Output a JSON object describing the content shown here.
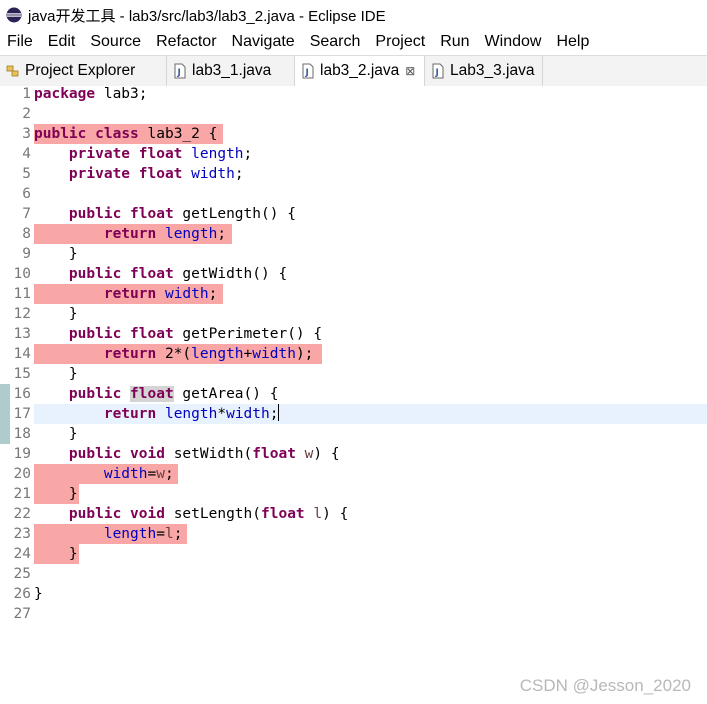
{
  "window": {
    "title": "java开发工具 - lab3/src/lab3/lab3_2.java - Eclipse IDE"
  },
  "menu": [
    "File",
    "Edit",
    "Source",
    "Refactor",
    "Navigate",
    "Search",
    "Project",
    "Run",
    "Window",
    "Help"
  ],
  "tabs": [
    {
      "label": "Project Explorer"
    },
    {
      "label": "lab3_1.java"
    },
    {
      "label": "lab3_2.java",
      "active": true,
      "close": "⊠"
    },
    {
      "label": "Lab3_3.java"
    }
  ],
  "code": {
    "lines": [
      {
        "n": "1",
        "t": [
          [
            "kw",
            "package"
          ],
          [
            "t",
            " lab3;"
          ]
        ]
      },
      {
        "n": "2",
        "t": []
      },
      {
        "n": "3",
        "t": [
          [
            "kw",
            "public"
          ],
          [
            "t",
            " "
          ],
          [
            "kw",
            "class"
          ],
          [
            "t",
            " lab3_2 {"
          ]
        ]
      },
      {
        "n": "4",
        "t": [
          [
            "t",
            "    "
          ],
          [
            "kw",
            "private"
          ],
          [
            "t",
            " "
          ],
          [
            "kw",
            "float"
          ],
          [
            "t",
            " "
          ],
          [
            "fd",
            "length"
          ],
          [
            "t",
            ";"
          ]
        ]
      },
      {
        "n": "5",
        "t": [
          [
            "t",
            "    "
          ],
          [
            "kw",
            "private"
          ],
          [
            "t",
            " "
          ],
          [
            "kw",
            "float"
          ],
          [
            "t",
            " "
          ],
          [
            "fd",
            "width"
          ],
          [
            "t",
            ";"
          ]
        ]
      },
      {
        "n": "6",
        "t": []
      },
      {
        "n": "7",
        "t": [
          [
            "t",
            "    "
          ],
          [
            "kw",
            "public"
          ],
          [
            "t",
            " "
          ],
          [
            "kw",
            "float"
          ],
          [
            "t",
            " getLength() {"
          ]
        ]
      },
      {
        "n": "8",
        "t": [
          [
            "t",
            "        "
          ],
          [
            "kw",
            "return"
          ],
          [
            "t",
            " "
          ],
          [
            "fd",
            "length"
          ],
          [
            "t",
            ";"
          ]
        ]
      },
      {
        "n": "9",
        "t": [
          [
            "t",
            "    }"
          ]
        ]
      },
      {
        "n": "10",
        "t": [
          [
            "t",
            "    "
          ],
          [
            "kw",
            "public"
          ],
          [
            "t",
            " "
          ],
          [
            "kw",
            "float"
          ],
          [
            "t",
            " getWidth() {"
          ]
        ]
      },
      {
        "n": "11",
        "t": [
          [
            "t",
            "        "
          ],
          [
            "kw",
            "return"
          ],
          [
            "t",
            " "
          ],
          [
            "fd",
            "width"
          ],
          [
            "t",
            ";"
          ]
        ]
      },
      {
        "n": "12",
        "t": [
          [
            "t",
            "    }"
          ]
        ]
      },
      {
        "n": "13",
        "t": [
          [
            "t",
            "    "
          ],
          [
            "kw",
            "public"
          ],
          [
            "t",
            " "
          ],
          [
            "kw",
            "float"
          ],
          [
            "t",
            " getPerimeter() {"
          ]
        ]
      },
      {
        "n": "14",
        "t": [
          [
            "t",
            "        "
          ],
          [
            "kw",
            "return"
          ],
          [
            "t",
            " 2*("
          ],
          [
            "fd",
            "length"
          ],
          [
            "t",
            "+"
          ],
          [
            "fd",
            "width"
          ],
          [
            "t",
            ");"
          ]
        ]
      },
      {
        "n": "15",
        "t": [
          [
            "t",
            "    }"
          ]
        ]
      },
      {
        "n": "16",
        "t": [
          [
            "t",
            "    "
          ],
          [
            "kw",
            "public"
          ],
          [
            "t",
            " "
          ],
          [
            "kwocc",
            "float"
          ],
          [
            "t",
            " getArea() {"
          ]
        ]
      },
      {
        "n": "17",
        "t": [
          [
            "t",
            "        "
          ],
          [
            "kw",
            "return"
          ],
          [
            "t",
            " "
          ],
          [
            "fd",
            "length"
          ],
          [
            "t",
            "*"
          ],
          [
            "fd",
            "width"
          ],
          [
            "t",
            ";"
          ],
          [
            "caret",
            ""
          ]
        ]
      },
      {
        "n": "18",
        "t": [
          [
            "t",
            "    }"
          ]
        ]
      },
      {
        "n": "19",
        "t": [
          [
            "t",
            "    "
          ],
          [
            "kw",
            "public"
          ],
          [
            "t",
            " "
          ],
          [
            "kw",
            "void"
          ],
          [
            "t",
            " setWidth("
          ],
          [
            "kw",
            "float"
          ],
          [
            "t",
            " "
          ],
          [
            "pm",
            "w"
          ],
          [
            "t",
            ") {"
          ]
        ]
      },
      {
        "n": "20",
        "t": [
          [
            "t",
            "        "
          ],
          [
            "fd",
            "width"
          ],
          [
            "t",
            "="
          ],
          [
            "pm",
            "w"
          ],
          [
            "t",
            ";"
          ]
        ]
      },
      {
        "n": "21",
        "t": [
          [
            "t",
            "    }"
          ]
        ]
      },
      {
        "n": "22",
        "t": [
          [
            "t",
            "    "
          ],
          [
            "kw",
            "public"
          ],
          [
            "t",
            " "
          ],
          [
            "kw",
            "void"
          ],
          [
            "t",
            " setLength("
          ],
          [
            "kw",
            "float"
          ],
          [
            "t",
            " "
          ],
          [
            "pm",
            "l"
          ],
          [
            "t",
            ") {"
          ]
        ]
      },
      {
        "n": "23",
        "t": [
          [
            "t",
            "        "
          ],
          [
            "fd",
            "length"
          ],
          [
            "t",
            "="
          ],
          [
            "pm",
            "l"
          ],
          [
            "t",
            ";"
          ]
        ]
      },
      {
        "n": "24",
        "t": [
          [
            "t",
            "    }"
          ]
        ]
      },
      {
        "n": "25",
        "t": []
      },
      {
        "n": "26",
        "t": [
          [
            "t",
            "}"
          ]
        ]
      },
      {
        "n": "27",
        "t": []
      }
    ]
  },
  "watermark": "CSDN @Jesson_2020",
  "colors": {
    "keyword": "#7f0055",
    "field": "#0000c0",
    "param": "#6a3e3e",
    "coverage": "#f8a6a6",
    "current_line": "#e8f2fe"
  }
}
